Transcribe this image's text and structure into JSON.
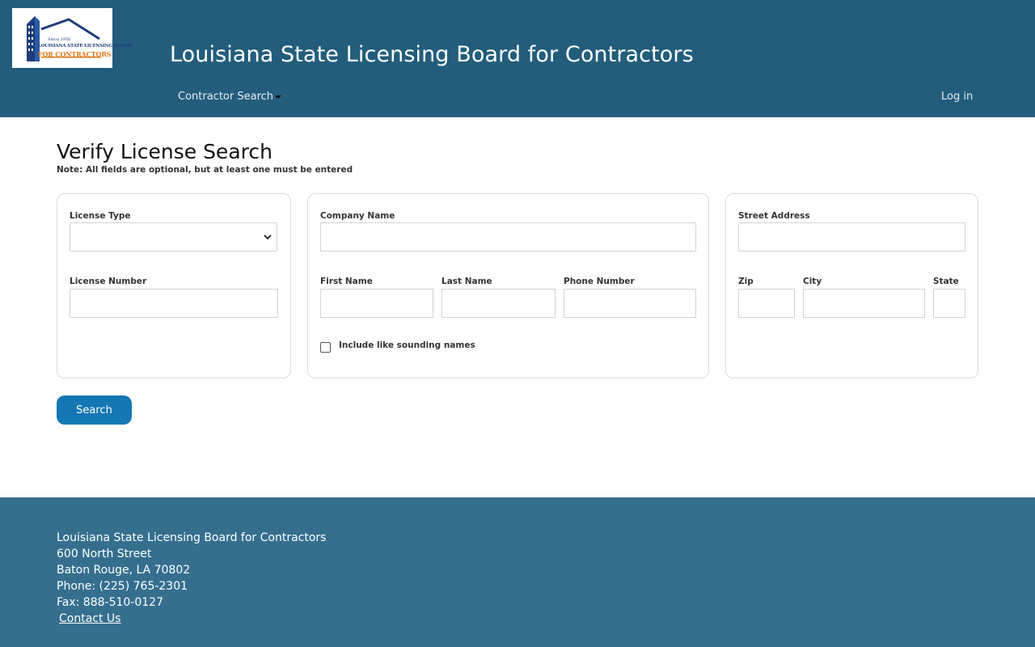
{
  "header": {
    "logo": {
      "since": "Since 1956",
      "line1": "LOUISIANA STATE LICENSING BOARD",
      "line2": "FOR CONTRACTORS"
    },
    "title": "Louisiana State Licensing Board for Contractors",
    "nav": {
      "contractor_search": "Contractor Search",
      "login": "Log in"
    }
  },
  "main": {
    "heading": "Verify License Search",
    "note": "Note: All fields are optional, but at least one must be entered",
    "fields": {
      "license_type": {
        "label": "License Type",
        "value": ""
      },
      "license_number": {
        "label": "License Number",
        "value": ""
      },
      "company_name": {
        "label": "Company Name",
        "value": ""
      },
      "first_name": {
        "label": "First Name",
        "value": ""
      },
      "last_name": {
        "label": "Last Name",
        "value": ""
      },
      "phone_number": {
        "label": "Phone Number",
        "value": ""
      },
      "street_address": {
        "label": "Street Address",
        "value": ""
      },
      "zip": {
        "label": "Zip",
        "value": ""
      },
      "city": {
        "label": "City",
        "value": ""
      },
      "state": {
        "label": "State",
        "value": ""
      }
    },
    "sounding_names": {
      "label": "Include like sounding names",
      "checked": false
    },
    "search_button": "Search"
  },
  "footer": {
    "org": "Louisiana State Licensing Board for Contractors",
    "street": "600 North Street",
    "city_state": "Baton Rouge, LA 70802",
    "phone": "Phone: (225) 765-2301",
    "fax": "Fax: 888-510-0127",
    "contact_link": "Contact Us"
  },
  "colors": {
    "header_bg": "#235d7c",
    "footer_bg": "#356f8e",
    "button_bg": "#1478b4"
  }
}
